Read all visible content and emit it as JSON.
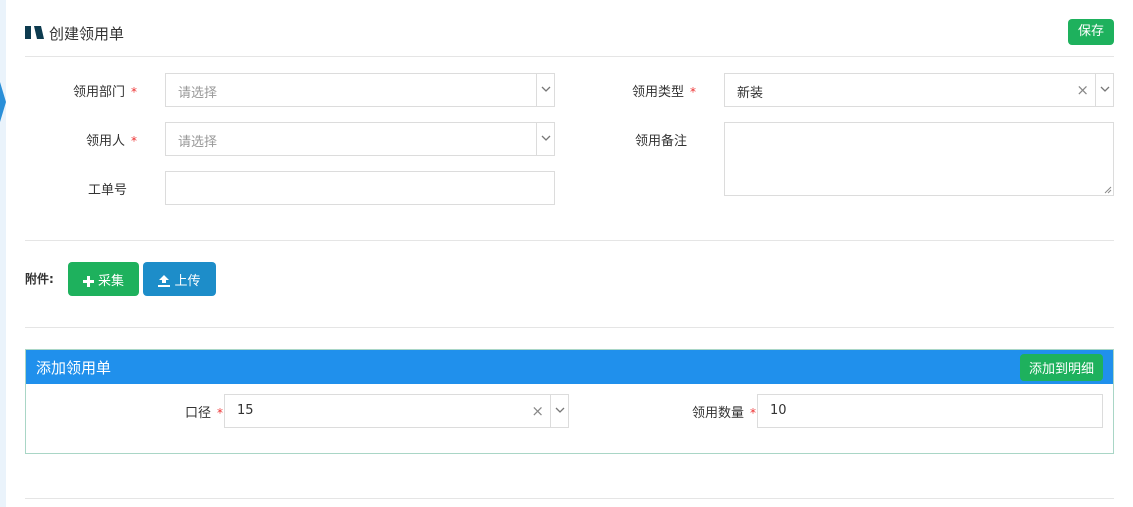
{
  "header": {
    "title": "创建领用单",
    "save_label": "保存"
  },
  "form": {
    "dept_label": "领用部门",
    "dept_placeholder": "请选择",
    "type_label": "领用类型",
    "type_value": "新装",
    "person_label": "领用人",
    "person_placeholder": "请选择",
    "remark_label": "领用备注",
    "order_label": "工单号",
    "required_mark": "*"
  },
  "attachments": {
    "label": "附件:",
    "collect_label": "采集",
    "upload_label": "上传"
  },
  "panel": {
    "title": "添加领用单",
    "add_button": "添加到明细",
    "caliber_label": "口径",
    "caliber_value": "15",
    "qty_label": "领用数量",
    "qty_value": "10"
  },
  "colors": {
    "primary_blue": "#2090ec",
    "success_green": "#1eb15d",
    "upload_blue": "#1d8dc9",
    "required_red": "#e33333"
  },
  "icons": {
    "logo": "bars-logo-icon",
    "collect": "plus-icon",
    "upload": "upload-icon",
    "caret": "chevron-down-icon",
    "clear": "close-icon"
  }
}
